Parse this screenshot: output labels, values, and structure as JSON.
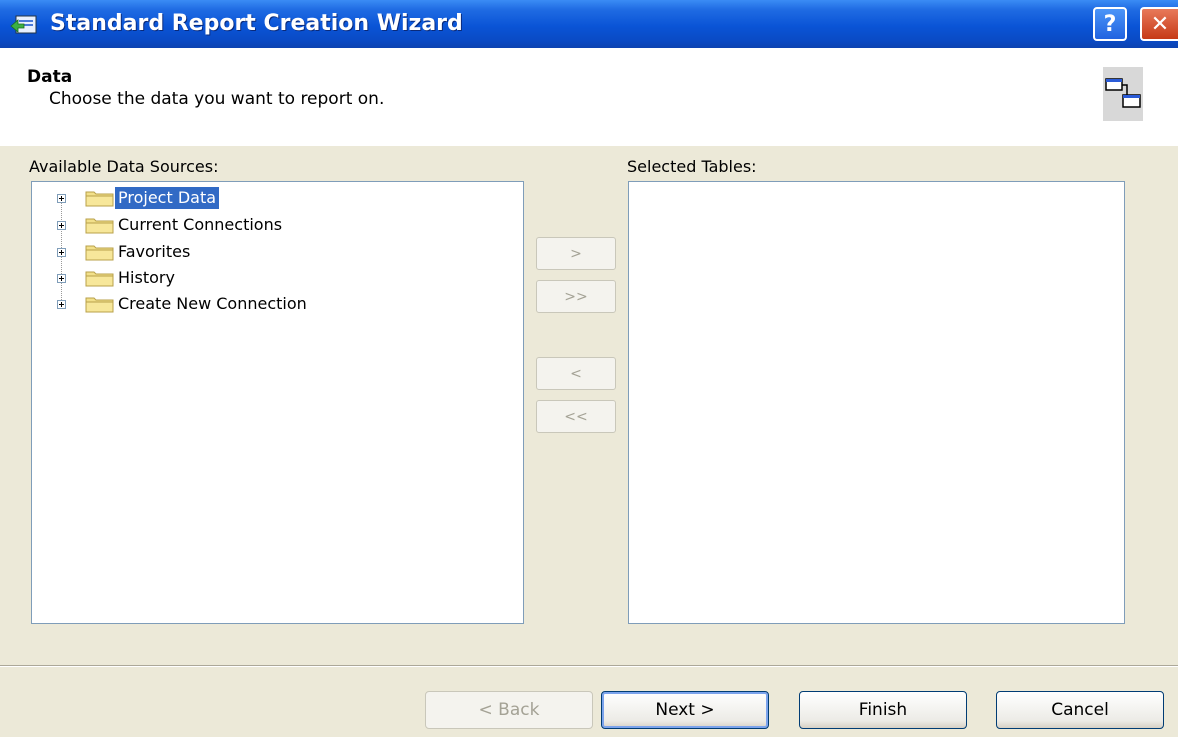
{
  "window": {
    "title": "Standard Report Creation Wizard",
    "help_label": "?",
    "close_label": "✕"
  },
  "header": {
    "title": "Data",
    "subtitle": "Choose the data you want to report on."
  },
  "available": {
    "label": "Available Data Sources:",
    "items": [
      {
        "label": "Project Data",
        "selected": true
      },
      {
        "label": "Current Connections",
        "selected": false
      },
      {
        "label": "Favorites",
        "selected": false
      },
      {
        "label": "History",
        "selected": false
      },
      {
        "label": "Create New Connection",
        "selected": false
      }
    ]
  },
  "selected": {
    "label": "Selected Tables:"
  },
  "move_buttons": {
    "add": ">",
    "add_all": ">>",
    "remove": "<",
    "remove_all": "<<"
  },
  "footer": {
    "back": "< Back",
    "next": "Next >",
    "finish": "Finish",
    "cancel": "Cancel"
  },
  "colors": {
    "titlebar": "#0a54d6",
    "selection": "#316ac5",
    "dialog_bg": "#ece9d8"
  }
}
